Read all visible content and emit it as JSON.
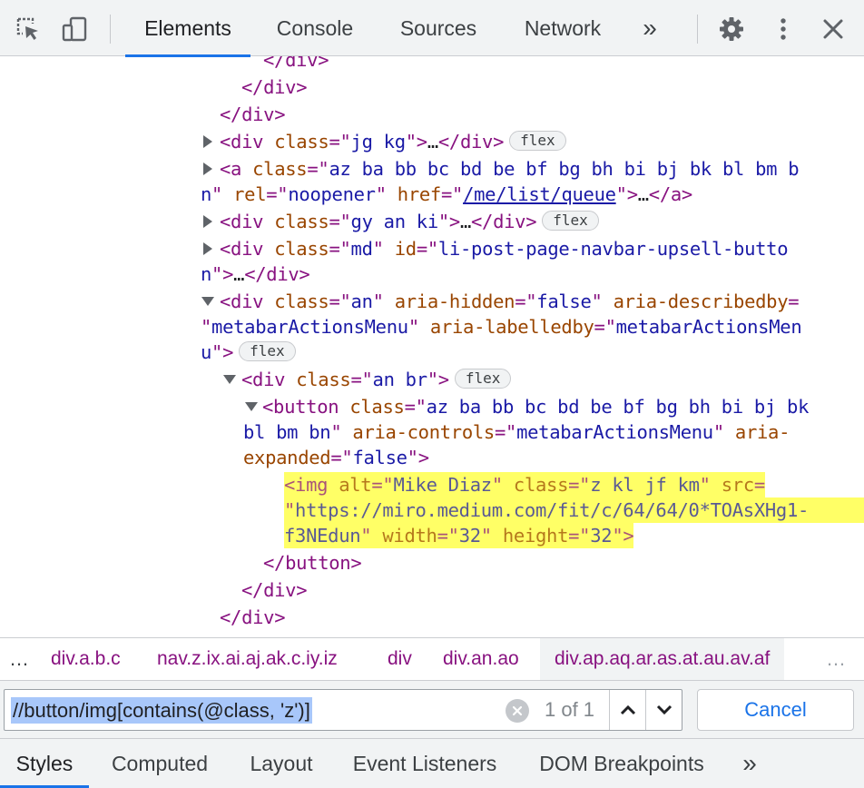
{
  "toolbar": {
    "tabs": [
      "Elements",
      "Console",
      "Sources",
      "Network"
    ],
    "more_tabs_glyph": "»",
    "icons": [
      "inspect-element-icon",
      "device-toolbar-icon",
      "settings-gear-icon",
      "kebab-menu-icon",
      "close-icon"
    ]
  },
  "tree": {
    "l0": {
      "tag": "</div>"
    },
    "l1": {
      "tag": "</div>"
    },
    "l2": {
      "tag": "</div>"
    },
    "l3": {
      "open": "<div",
      "a1": " class",
      "eq1": "=\"",
      "v1": "jg kg",
      "q1": "\"",
      "close": ">",
      "ell": "…",
      "end": "</div>",
      "badge": "flex"
    },
    "l4": {
      "open": "<a",
      "a1": " class",
      "eq1": "=\"",
      "v1": "az ba bb bc bd be bf bg bh bi bj bk bl bm b"
    },
    "l5": {
      "v1": "n",
      "q1": "\"",
      "a2": " rel",
      "eq2": "=\"",
      "v2": "noopener",
      "q2": "\"",
      "a3": " href",
      "eq3": "=\"",
      "link": "/me/list/queue",
      "q3": "\"",
      "close": ">",
      "ell": "…",
      "end": "</a>"
    },
    "l6": {
      "open": "<div",
      "a1": " class",
      "eq1": "=\"",
      "v1": "gy an ki",
      "q1": "\"",
      "close": ">",
      "ell": "…",
      "end": "</div>",
      "badge": "flex"
    },
    "l7": {
      "open": "<div",
      "a1": " class",
      "eq1": "=\"",
      "v1": "md",
      "q1": "\"",
      "a2": " id",
      "eq2": "=\"",
      "v2": "li-post-page-navbar-upsell-butto"
    },
    "l8": {
      "v1": "n",
      "q1": "\"",
      "close": ">",
      "ell": "…",
      "end": "</div>"
    },
    "l9": {
      "open": "<div",
      "a1": " class",
      "eq1": "=\"",
      "v1": "an",
      "q1": "\"",
      "a2": " aria-hidden",
      "eq2": "=\"",
      "v2": "false",
      "q2": "\"",
      "a3": " aria-describedby",
      "eq3": "="
    },
    "l10": {
      "q0": "\"",
      "v1": "metabarActionsMenu",
      "q1": "\"",
      "a2": " aria-labelledby",
      "eq2": "=\"",
      "v2": "metabarActionsMen"
    },
    "l11": {
      "v1": "u",
      "q1": "\"",
      "close": ">",
      "badge": "flex"
    },
    "l12": {
      "open": "<div",
      "a1": " class",
      "eq1": "=\"",
      "v1": "an br",
      "q1": "\"",
      "close": ">",
      "badge": "flex"
    },
    "l13": {
      "open": "<button",
      "a1": " class",
      "eq1": "=\"",
      "v1": "az ba bb bc bd be bf bg bh bi bj bk"
    },
    "l14": {
      "v1": "bl bm bn",
      "q1": "\"",
      "a2": " aria-controls",
      "eq2": "=\"",
      "v2": "metabarActionsMenu",
      "q2": "\"",
      "a3": " aria-"
    },
    "l15": {
      "a1": "expanded",
      "eq1": "=\"",
      "v1": "false",
      "q1": "\"",
      "close": ">"
    },
    "l16": {
      "open": "<img",
      "a1": " alt",
      "eq1": "=\"",
      "v1": "Mike Diaz",
      "q1": "\"",
      "a2": " class",
      "eq2": "=\"",
      "v2": "z kl jf km",
      "q2": "\"",
      "a3": " src",
      "eq3": "="
    },
    "l17": {
      "q0": "\"",
      "v1": "https://miro.medium.com/fit/c/64/64/0*TOAsXHg1-"
    },
    "l18": {
      "v1": "f3NEdun",
      "q1": "\"",
      "a2": " width",
      "eq2": "=\"",
      "v2": "32",
      "q2": "\"",
      "a3": " height",
      "eq3": "=\"",
      "v3": "32",
      "q3": "\"",
      "close": ">"
    },
    "l19": {
      "tag": "</button>"
    },
    "l20": {
      "tag": "</div>"
    },
    "l21": {
      "tag": "</div>"
    }
  },
  "breadcrumbs": {
    "items": [
      "div.a.b.c",
      "nav.z.ix.ai.aj.ak.c.iy.iz",
      "div",
      "div.an.ao",
      "div.ap.aq.ar.as.at.au.av.af"
    ],
    "overflow_left": "…",
    "overflow_right": "…"
  },
  "search": {
    "query": "//button/img[contains(@class, 'z')]",
    "match_count": "1 of 1",
    "cancel_label": "Cancel"
  },
  "bottom_tabs": {
    "tabs": [
      "Styles",
      "Computed",
      "Layout",
      "Event Listeners",
      "DOM Breakpoints"
    ],
    "more_glyph": "»"
  },
  "colors": {
    "accent": "#1a73e8",
    "tag": "#881280",
    "attribute": "#994500",
    "value": "#1a1aa6",
    "highlight": "#ffff66",
    "selection": "#a8c7fa"
  }
}
